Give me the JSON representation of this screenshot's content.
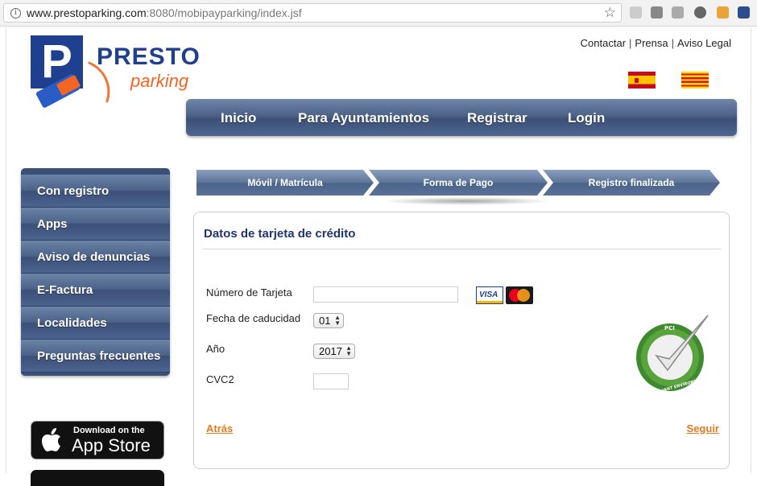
{
  "browser": {
    "url_host": "www.prestoparking.com",
    "url_rest": ":8080/mobipayparking/index.jsf"
  },
  "logo": {
    "brand": "PRESTO",
    "sub": "parking",
    "letter": "P"
  },
  "toplinks": [
    "Contactar",
    "Prensa",
    "Aviso Legal"
  ],
  "mainnav": [
    "Inicio",
    "Para Ayuntamientos",
    "Registrar",
    "Login"
  ],
  "sidebar": [
    "Con registro",
    "Apps",
    "Aviso de denuncias",
    "E-Factura",
    "Localidades",
    "Preguntas frecuentes"
  ],
  "appstore": {
    "small": "Download on the",
    "big": "App Store"
  },
  "steps": [
    "Móvil / Matrícula",
    "Forma de Pago",
    "Registro finalizada"
  ],
  "form": {
    "title": "Datos de tarjeta de crédito",
    "card_number_label": "Número de Tarjeta",
    "card_number_value": "",
    "expiry_label": "Fecha de caducidad",
    "expiry_value": "01",
    "year_label": "Año",
    "year_value": "2017",
    "cvc_label": "CVC2",
    "cvc_value": "",
    "visa_text": "VISA",
    "pci_top": "PCI",
    "pci_bottom": "COMPLIANT ENVIRONMENT"
  },
  "actions": {
    "back": "Atrás",
    "next": "Seguir"
  },
  "colors": {
    "nav_blue": "#4c6288",
    "title_blue": "#1f3470",
    "link_orange": "#e47b1c",
    "brand_blue": "#1f3f8f",
    "brand_orange": "#f26522"
  }
}
